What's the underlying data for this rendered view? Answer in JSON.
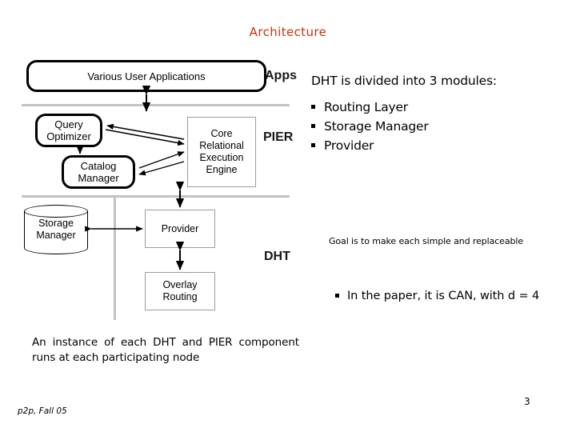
{
  "slide": {
    "title": "Architecture",
    "title_color": "#C0360E",
    "footer_left": "p2p, Fall 05",
    "page_number": "3"
  },
  "diagram": {
    "boxes": {
      "various_user_applications": "Various User Applications",
      "query_optimizer": "Query\nOptimizer",
      "catalog_manager": "Catalog\nManager",
      "core_relational_execution_engine": "Core\nRelational\nExecution\nEngine",
      "storage_manager": "Storage\nManager",
      "provider": "Provider",
      "overlay_routing": "Overlay\nRouting"
    },
    "band_labels": {
      "apps": "Apps",
      "pier": "PIER",
      "dht": "DHT"
    }
  },
  "content": {
    "lead": "DHT is divided into 3 modules:",
    "modules": [
      "Routing Layer",
      "Storage Manager",
      "Provider"
    ],
    "goal_note": "Goal is to make each simple and replaceable",
    "paper_note": "In the paper, it is CAN, with d = 4",
    "instance_note": "An instance of each DHT and PIER component runs at each participating node"
  }
}
